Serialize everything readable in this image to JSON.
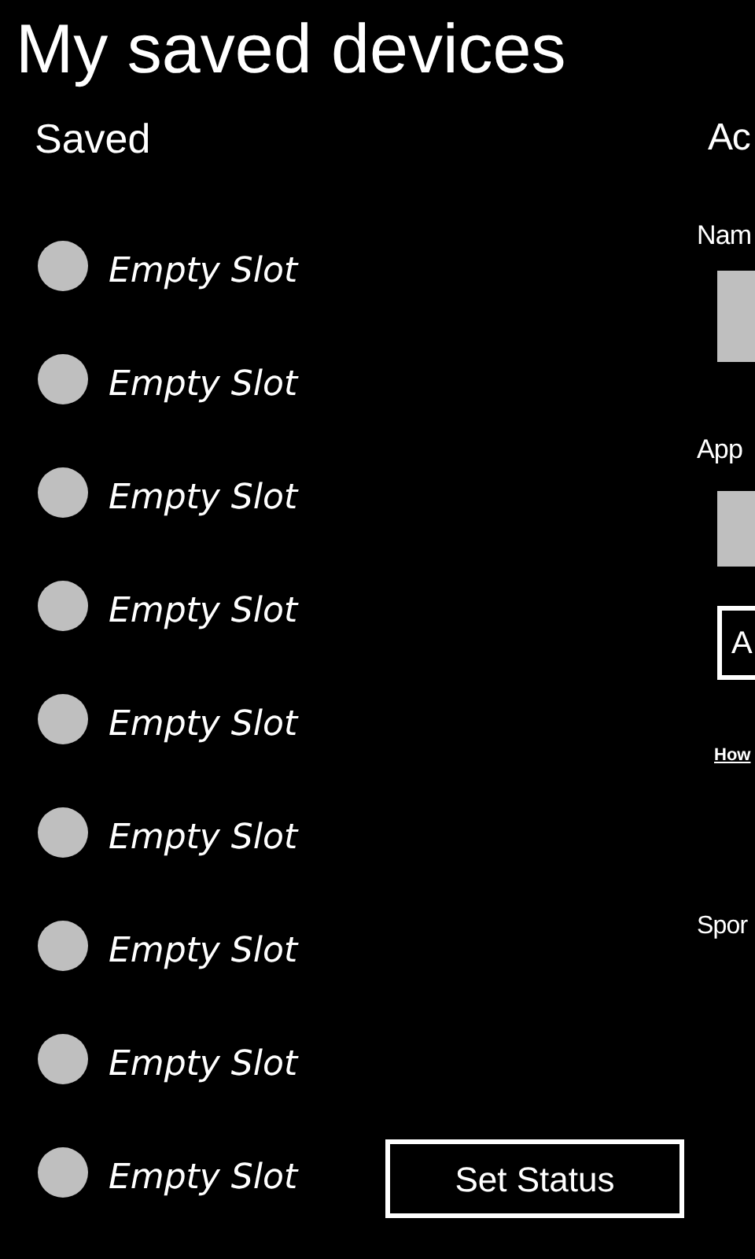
{
  "title": "My saved devices",
  "saved": {
    "heading": "Saved",
    "slots": [
      {
        "label": "Empty Slot"
      },
      {
        "label": "Empty Slot"
      },
      {
        "label": "Empty Slot"
      },
      {
        "label": "Empty Slot"
      },
      {
        "label": "Empty Slot"
      },
      {
        "label": "Empty Slot"
      },
      {
        "label": "Empty Slot"
      },
      {
        "label": "Empty Slot"
      },
      {
        "label": "Empty Slot"
      }
    ],
    "button": "Set Status"
  },
  "add_panel": {
    "heading": "Ac",
    "name_label": "Nam",
    "app_label": "App",
    "button": "A",
    "link": "How",
    "footer_label": "Spor"
  }
}
